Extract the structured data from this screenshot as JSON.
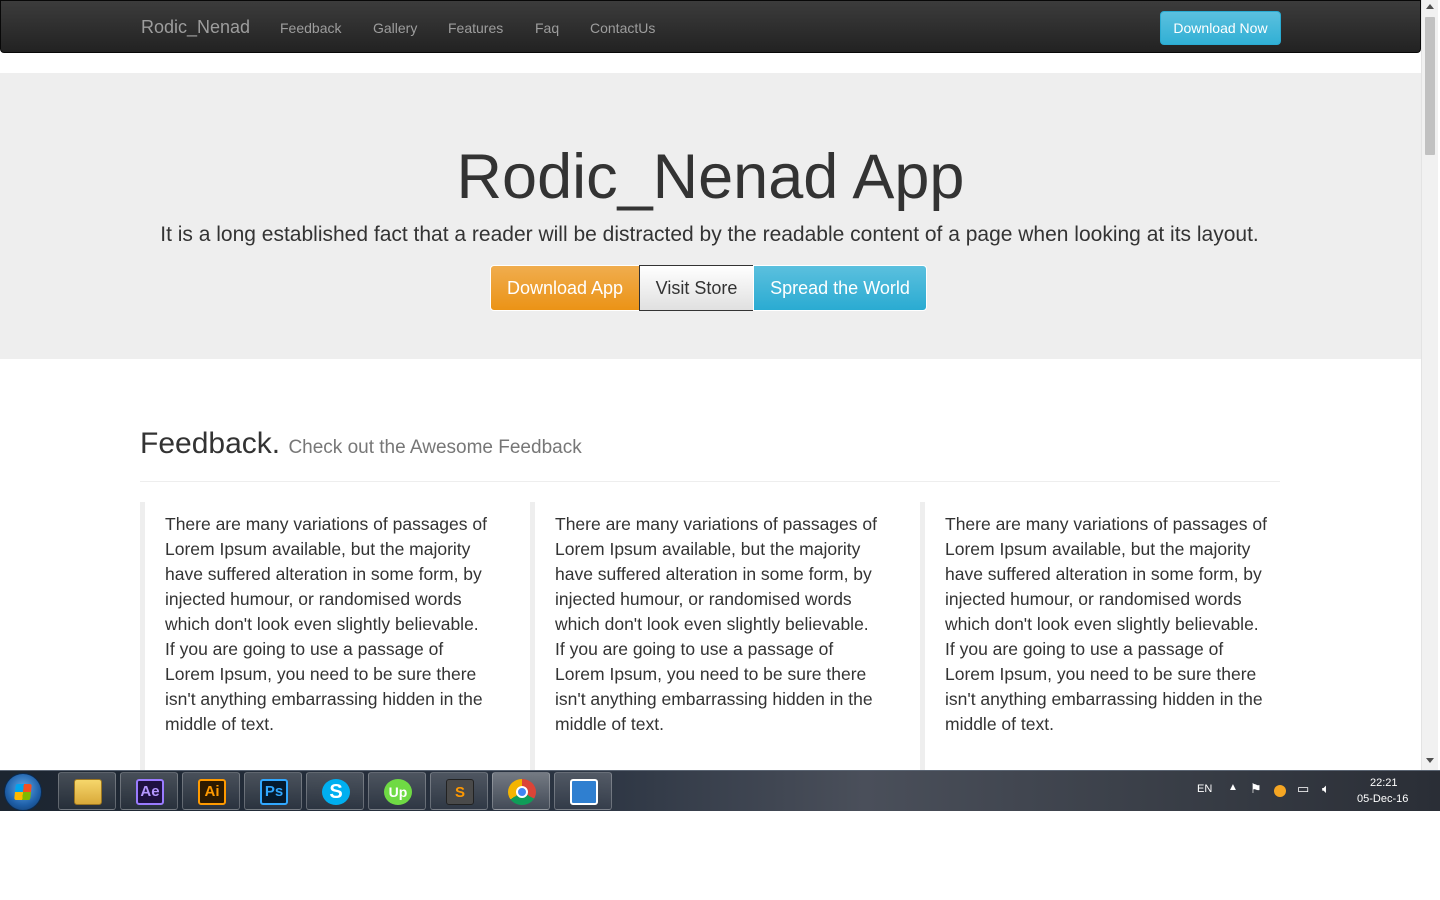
{
  "navbar": {
    "brand": "Rodic_Nenad",
    "links": [
      "Feedback",
      "Gallery",
      "Features",
      "Faq",
      "ContactUs"
    ],
    "download_button": "Download Now"
  },
  "hero": {
    "title": "Rodic_Nenad App",
    "subtitle": "It is a long established fact that a reader will be distracted by the readable content of a page when looking at its layout.",
    "buttons": [
      "Download App",
      "Visit Store",
      "Spread the World"
    ]
  },
  "feedback": {
    "heading": "Feedback.",
    "subheading": "Check out the Awesome Feedback",
    "quotes": [
      "There are many variations of passages of Lorem Ipsum available, but the majority have suffered alteration in some form, by injected humour, or randomised words which don't look even slightly believable. If you are going to use a passage of Lorem Ipsum, you need to be sure there isn't anything embarrassing hidden in the middle of text.",
      "There are many variations of passages of Lorem Ipsum available, but the majority have suffered alteration in some form, by injected humour, or randomised words which don't look even slightly believable. If you are going to use a passage of Lorem Ipsum, you need to be sure there isn't anything embarrassing hidden in the middle of text.",
      "There are many variations of passages of Lorem Ipsum available, but the majority have suffered alteration in some form, by injected humour, or randomised words which don't look even slightly believable. If you are going to use a passage of Lorem Ipsum, you need to be sure there isn't anything embarrassing hidden in the middle of text."
    ]
  },
  "taskbar": {
    "apps": [
      {
        "name": "windows-explorer",
        "label": ""
      },
      {
        "name": "after-effects",
        "label": "Ae"
      },
      {
        "name": "illustrator",
        "label": "Ai"
      },
      {
        "name": "photoshop",
        "label": "Ps"
      },
      {
        "name": "skype",
        "label": "S"
      },
      {
        "name": "upwork",
        "label": "Up"
      },
      {
        "name": "sublime-text",
        "label": "S"
      },
      {
        "name": "chrome",
        "label": ""
      },
      {
        "name": "app",
        "label": ""
      }
    ],
    "language": "EN",
    "time": "22:21",
    "date": "05-Dec-16"
  },
  "colors": {
    "navbar": "#222222",
    "jumbotron": "#eeeeee",
    "warning": "#f0ad4e",
    "info": "#5bc0de"
  }
}
